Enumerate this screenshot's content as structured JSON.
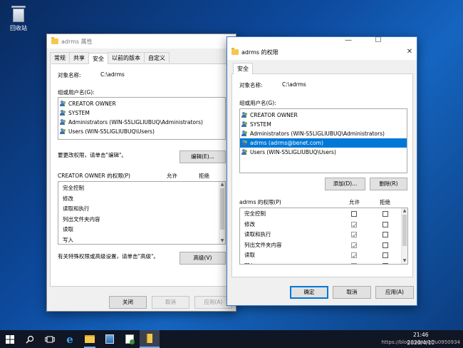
{
  "desktop": {
    "recycle_bin_label": "回收站"
  },
  "props_window": {
    "title": "adrms 属性",
    "tabs": [
      "常规",
      "共享",
      "安全",
      "以前的版本",
      "自定义"
    ],
    "object_label": "对象名称:",
    "object_value": "C:\\adrms",
    "group_label": "组或用户名(G):",
    "users": [
      "CREATOR OWNER",
      "SYSTEM",
      "Administrators (WIN-S5LIGLIUBUQ\\Administrators)",
      "Users (WIN-S5LIGLIUBUQ\\Users)"
    ],
    "change_hint": "要更改权限，请单击\"编辑\"。",
    "edit_button": "编辑(E)...",
    "perm_title": "CREATOR OWNER 的权限(P)",
    "allow_header": "允许",
    "deny_header": "拒绝",
    "permissions": [
      "完全控制",
      "修改",
      "读取和执行",
      "列出文件夹内容",
      "读取",
      "写入"
    ],
    "advanced_hint": "有关特殊权限或高级设置，请单击\"高级\"。",
    "advanced_button": "高级(V)",
    "ok_button": "关闭",
    "cancel_button": "取消",
    "apply_button": "应用(A)"
  },
  "perm_window": {
    "title": "adrms 的权限",
    "tab": "安全",
    "object_label": "对象名称:",
    "object_value": "C:\\adrms",
    "group_label": "组或用户名(G):",
    "users": [
      "CREATOR OWNER",
      "SYSTEM",
      "Administrators (WIN-S5LIGLIUBUQ\\Administrators)",
      "adrms (adrms@benet.com)",
      "Users (WIN-S5LIGLIUBUQ\\Users)"
    ],
    "selected_user_index": 3,
    "add_button": "添加(D)...",
    "remove_button": "删除(R)",
    "perm_title": "adrms 的权限(P)",
    "allow_header": "允许",
    "deny_header": "拒绝",
    "permissions": [
      {
        "name": "完全控制",
        "allow": false,
        "deny": false
      },
      {
        "name": "修改",
        "allow": true,
        "deny": false
      },
      {
        "name": "读取和执行",
        "allow": true,
        "deny": false
      },
      {
        "name": "列出文件夹内容",
        "allow": true,
        "deny": false
      },
      {
        "name": "读取",
        "allow": true,
        "deny": false
      },
      {
        "name": "写入",
        "allow": true,
        "deny": false
      }
    ],
    "ok_button": "确定",
    "cancel_button": "取消",
    "apply_button": "应用(A)"
  },
  "taskbar": {
    "time": "21:46",
    "date": "2020/4/10",
    "watermark": "https://blog.csdn.net/u0950934"
  }
}
